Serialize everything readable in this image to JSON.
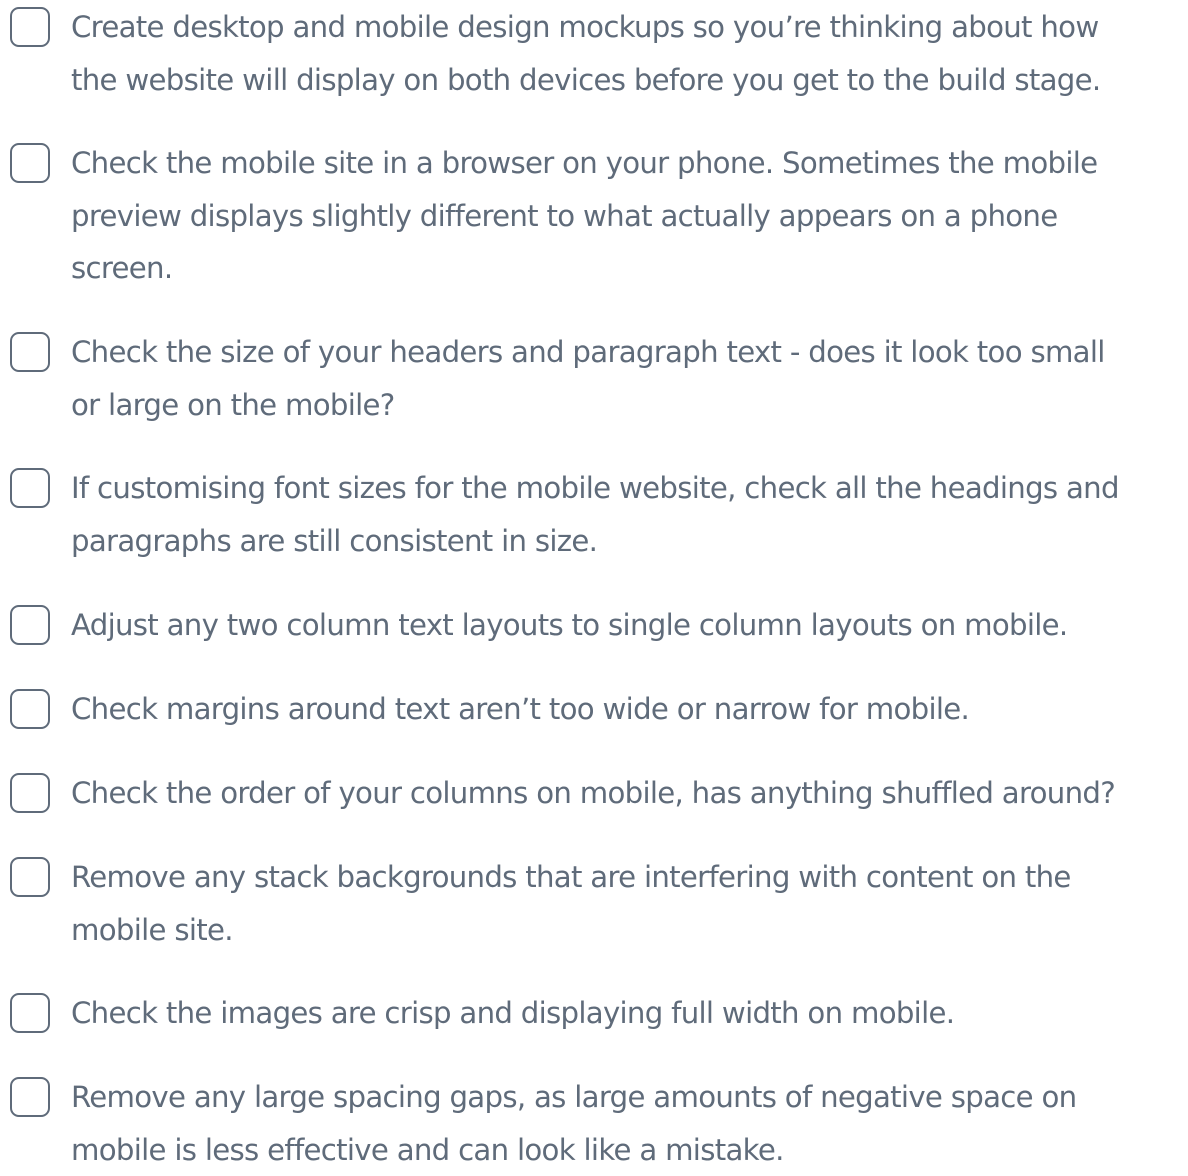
{
  "checklist": {
    "items": [
      {
        "checked": false,
        "lines": [
          "Create desktop and mobile design mockups so you’re thinking about how",
          "the website will display on both devices before you get to the build stage."
        ]
      },
      {
        "checked": false,
        "lines": [
          "Check the mobile site in a browser on your phone. Sometimes the mobile",
          "preview displays slightly different to what actually appears on a phone",
          "screen."
        ]
      },
      {
        "checked": false,
        "lines": [
          "Check the size of your headers and paragraph text - does it look too small",
          "or large on the mobile?"
        ]
      },
      {
        "checked": false,
        "lines": [
          "If customising font sizes for the mobile website, check all the headings and",
          "paragraphs are still consistent in size."
        ]
      },
      {
        "checked": false,
        "lines": [
          "Adjust any two column text layouts to single column layouts on mobile."
        ]
      },
      {
        "checked": false,
        "lines": [
          "Check margins around text aren’t too wide or narrow for mobile."
        ]
      },
      {
        "checked": false,
        "lines": [
          "Check the order of your columns on mobile, has anything shuffled around?"
        ]
      },
      {
        "checked": false,
        "lines": [
          "Remove any stack backgrounds that are interfering with content on the",
          "mobile site."
        ]
      },
      {
        "checked": false,
        "lines": [
          "Check the images are crisp and displaying full width on mobile."
        ]
      },
      {
        "checked": false,
        "lines": [
          "Remove any large spacing gaps, as large amounts of negative space on",
          "mobile is less effective and can look like a mistake."
        ]
      }
    ]
  }
}
